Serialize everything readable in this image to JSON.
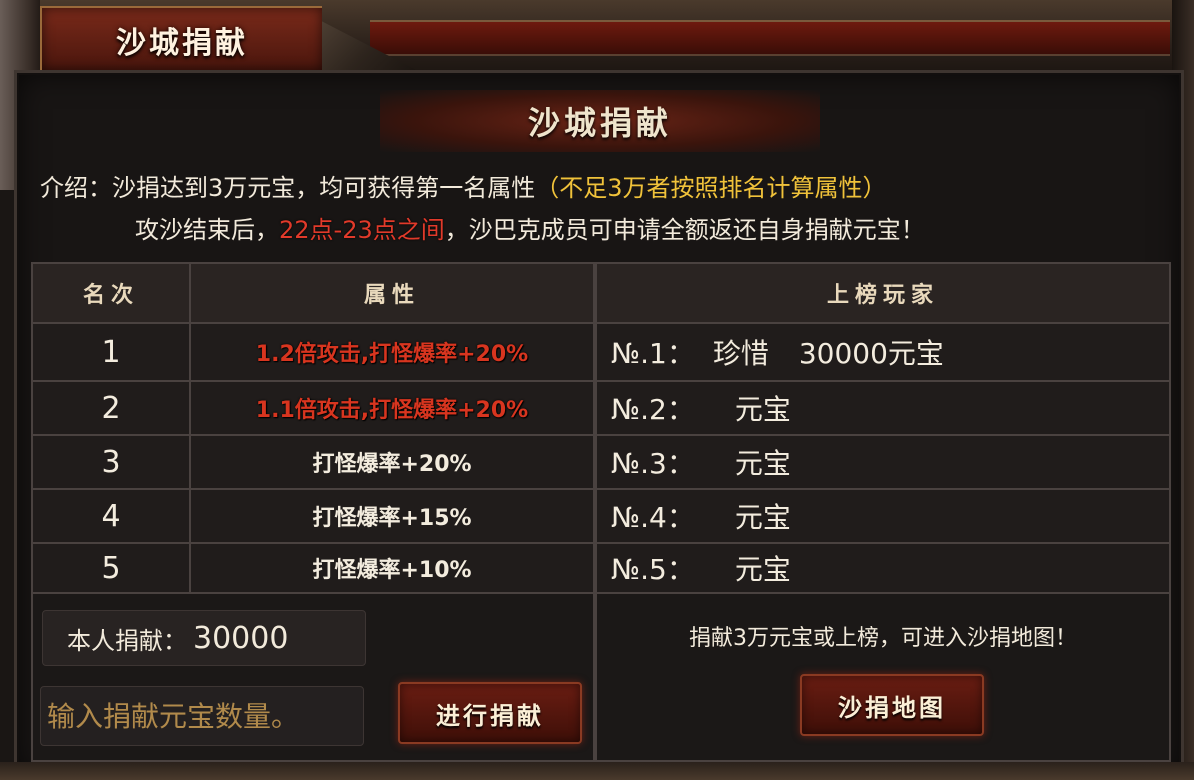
{
  "window": {
    "tab_title": "沙城捐献"
  },
  "header": {
    "title": "沙城捐献"
  },
  "intro": {
    "line1_prefix": "介绍：沙捐达到3万元宝，均可获得第一名属性",
    "line1_highlight": "（不足3万者按照排名计算属性）",
    "line2_prefix": "攻沙结束后，",
    "line2_time": "22点-23点之间",
    "line2_suffix": "，沙巴克成员可申请全额返还自身捐献元宝！"
  },
  "table": {
    "headers": {
      "rank": "名次",
      "attribute": "属性",
      "players": "上榜玩家"
    },
    "rows": [
      {
        "rank": "1",
        "attribute": "1.2倍攻击,打怪爆率+20%",
        "player_no": "№.1：",
        "player_name": "珍惜",
        "amount": "30000元宝"
      },
      {
        "rank": "2",
        "attribute": "1.1倍攻击,打怪爆率+20%",
        "player_no": "№.2：",
        "player_name": "",
        "amount": "元宝"
      },
      {
        "rank": "3",
        "attribute": "打怪爆率+20%",
        "player_no": "№.3：",
        "player_name": "",
        "amount": "元宝"
      },
      {
        "rank": "4",
        "attribute": "打怪爆率+15%",
        "player_no": "№.4：",
        "player_name": "",
        "amount": "元宝"
      },
      {
        "rank": "5",
        "attribute": "打怪爆率+10%",
        "player_no": "№.5：",
        "player_name": "",
        "amount": "元宝"
      }
    ]
  },
  "donation": {
    "my_label": "本人捐献：",
    "my_value": "30000",
    "input_placeholder": "输入捐献元宝数量。",
    "donate_button": "进行捐献"
  },
  "map": {
    "hint": "捐献3万元宝或上榜，可进入沙捐地图！",
    "button": "沙捐地图"
  },
  "colors": {
    "highlight_gold": "#f0c23a",
    "highlight_red": "#e13a2a",
    "button_red": "#6a1d12"
  }
}
